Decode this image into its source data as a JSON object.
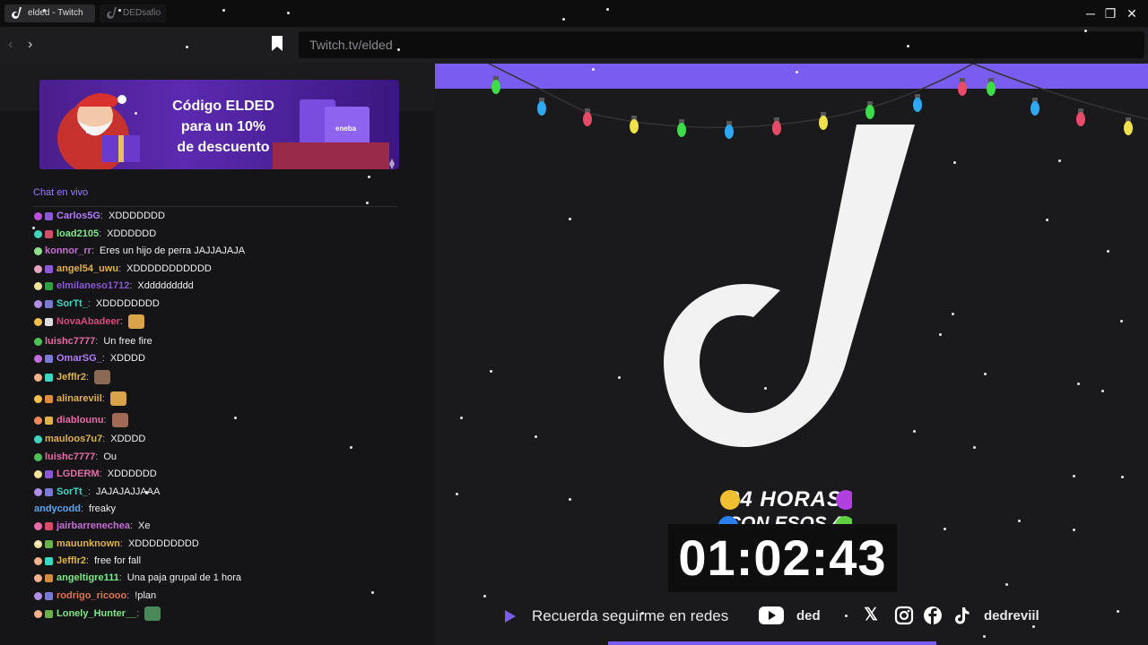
{
  "tabs": [
    {
      "label": "elded - Twitch"
    },
    {
      "label": "DEDsafio"
    }
  ],
  "window_controls": {
    "minimize": "─",
    "restore": "❐",
    "close": "✕"
  },
  "nav": {
    "back": "‹",
    "forward": "›",
    "url": "Twitch.tv/elded"
  },
  "banner": {
    "line1": "Código ELDED",
    "line2": "para un 10%",
    "line3": "de descuento",
    "brand": "eneba"
  },
  "chat": {
    "header": "Chat en vivo",
    "messages": [
      {
        "user": "Carlos5G",
        "color": "#b07df5",
        "text": "XDDDDDDD",
        "b1": "#c04ddd",
        "b2": "#8a57d6"
      },
      {
        "user": "load2105",
        "color": "#7ee787",
        "text": "XDDDDDD",
        "b1": "#3fd6c1",
        "b2": "#d34c6a"
      },
      {
        "user": "konnor_rr",
        "color": "#c86dd7",
        "text": "Eres un hijo de perra JAJJAJAJA",
        "b1": "#8fe08a",
        "b2": ""
      },
      {
        "user": "angel54_uwu",
        "color": "#e0b24a",
        "text": "XDDDDDDDDDDD",
        "b1": "#e7a4c2",
        "b2": "#8a57d6"
      },
      {
        "user": "elmilaneso1712",
        "color": "#8a57d6",
        "text": "Xddddddddd",
        "b1": "#f1e39a",
        "b2": "#2ea043"
      },
      {
        "user": "SorTt_",
        "color": "#3fd6c1",
        "text": "XDDDDDDDD",
        "b1": "#b08ee8",
        "b2": "#7a7ad6"
      },
      {
        "user": "NovaAbadeer",
        "color": "#d94a7b",
        "text": "",
        "b1": "#f3c14a",
        "b2": "#dddddd",
        "emote": "#d9a34a"
      },
      {
        "user": "luishc7777",
        "color": "#e86ba8",
        "text": "Un free fire",
        "b1": "#4ec05a",
        "b2": ""
      },
      {
        "user": "OmarSG_",
        "color": "#b07df5",
        "text": "XDDDD",
        "b1": "#c46be0",
        "b2": "#7a7ad6"
      },
      {
        "user": "Jefflr2",
        "color": "#e0b24a",
        "text": "",
        "b1": "#f2b38a",
        "b2": "#3fd6c1",
        "emote": "#8a6a55"
      },
      {
        "user": "alinareviil",
        "color": "#e0b24a",
        "text": "",
        "b1": "#f3c14a",
        "b2": "#e08a3a",
        "emote": "#d9a34a"
      },
      {
        "user": "diablounu",
        "color": "#e86ba8",
        "text": "",
        "b1": "#f08a5a",
        "b2": "#e0b24a",
        "emote": "#a06a55"
      },
      {
        "user": "mauloos7u7",
        "color": "#e0b24a",
        "text": "XDDDD",
        "b1": "#3fd6c1",
        "b2": ""
      },
      {
        "user": "luishc7777",
        "color": "#e86ba8",
        "text": "Ou",
        "b1": "#4ec05a",
        "b2": ""
      },
      {
        "user": "LGDERM",
        "color": "#e86ba8",
        "text": "XDDDDDD",
        "b1": "#f1e39a",
        "b2": "#8a57d6"
      },
      {
        "user": "SorTt_",
        "color": "#3fd6c1",
        "text": "JAJAJAJJAAA",
        "b1": "#b08ee8",
        "b2": "#7a7ad6"
      },
      {
        "user": "andycodd",
        "color": "#5aa6f0",
        "text": "freaky",
        "b1": "",
        "b2": ""
      },
      {
        "user": "jairbarrenechea",
        "color": "#c86dd7",
        "text": "Xe",
        "b1": "#e86ba8",
        "b2": "#d34c6a"
      },
      {
        "user": "mauunknown",
        "color": "#e0b24a",
        "text": "XDDDDDDDDD",
        "b1": "#f1e39a",
        "b2": "#6ab04c"
      },
      {
        "user": "Jefflr2",
        "color": "#e0b24a",
        "text": "free for fall",
        "b1": "#f2b38a",
        "b2": "#3fd6c1"
      },
      {
        "user": "angeltigre111",
        "color": "#7ee787",
        "text": "Una paja grupal de 1 hora",
        "b1": "#f2b38a",
        "b2": "#d88a3a"
      },
      {
        "user": "rodrigo_ricooo",
        "color": "#e0734a",
        "text": "!plan",
        "b1": "#b08ee8",
        "b2": "#7a7ad6"
      },
      {
        "user": "Lonely_Hunter__",
        "color": "#7ee787",
        "text": "",
        "b1": "#f2b38a",
        "b2": "#6ab04c",
        "emote": "#4a8a5a"
      }
    ]
  },
  "stream": {
    "event_line1": "24 HORAS",
    "event_line2": "CON ESOS 4",
    "timer": "01:02:43",
    "prompt": "Recuerda seguirme en redes",
    "youtube_handle": "ded",
    "social_handle": "dedreviil",
    "icons": [
      "play-icon",
      "youtube-icon",
      "x-icon",
      "instagram-icon",
      "facebook-icon",
      "tiktok-icon"
    ],
    "accent": "#7b5cf0"
  }
}
